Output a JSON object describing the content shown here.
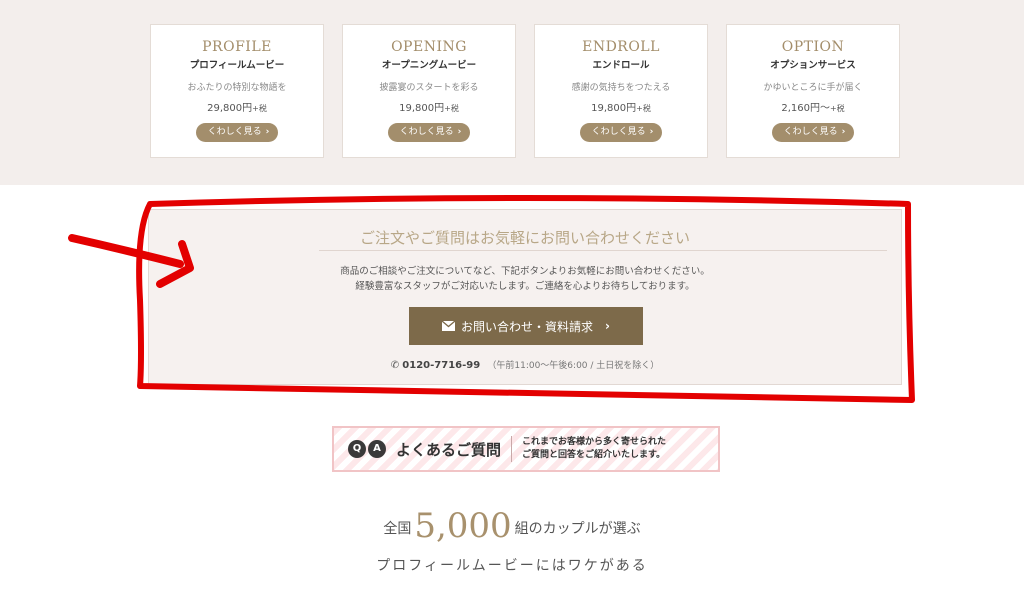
{
  "products": [
    {
      "en": "PROFILE",
      "ja": "プロフィールムービー",
      "desc": "おふたりの特別な物語を",
      "price": "29,800円",
      "tax": "+税",
      "button": "くわしく見る"
    },
    {
      "en": "OPENING",
      "ja": "オープニングムービー",
      "desc": "披露宴のスタートを彩る",
      "price": "19,800円",
      "tax": "+税",
      "button": "くわしく見る"
    },
    {
      "en": "ENDROLL",
      "ja": "エンドロール",
      "desc": "感謝の気持ちをつたえる",
      "price": "19,800円",
      "tax": "+税",
      "button": "くわしく見る"
    },
    {
      "en": "OPTION",
      "ja": "オプションサービス",
      "desc": "かゆいところに手が届く",
      "price": "2,160円〜",
      "tax": "+税",
      "button": "くわしく見る"
    }
  ],
  "contact": {
    "heading": "ご注文やご質問はお気軽にお問い合わせください",
    "line1": "商品のご相談やご注文についてなど、下記ボタンよりお気軽にお問い合わせください。",
    "line2": "経験豊富なスタッフがご対応いたします。ご連絡を心よりお待ちしております。",
    "button_label": "お問い合わせ・資料請求",
    "phone": "0120-7716-99",
    "hours": "（午前11:00〜午後6:00 / 土日祝を除く）"
  },
  "faq": {
    "q_letter": "Q",
    "a_letter": "A",
    "title": "よくあるご質問",
    "sub1": "これまでお客様から多く寄せられた",
    "sub2": "ご質問と回答をご紹介いたします。"
  },
  "tagline": {
    "prefix": "全国",
    "number": "5,000",
    "suffix": "組のカップルが選ぶ",
    "line2": "プロフィールムービーにはワケがある"
  },
  "colors": {
    "accent": "#a38e6c",
    "button_dark": "#7d6a4a",
    "annotation": "#e30000"
  }
}
